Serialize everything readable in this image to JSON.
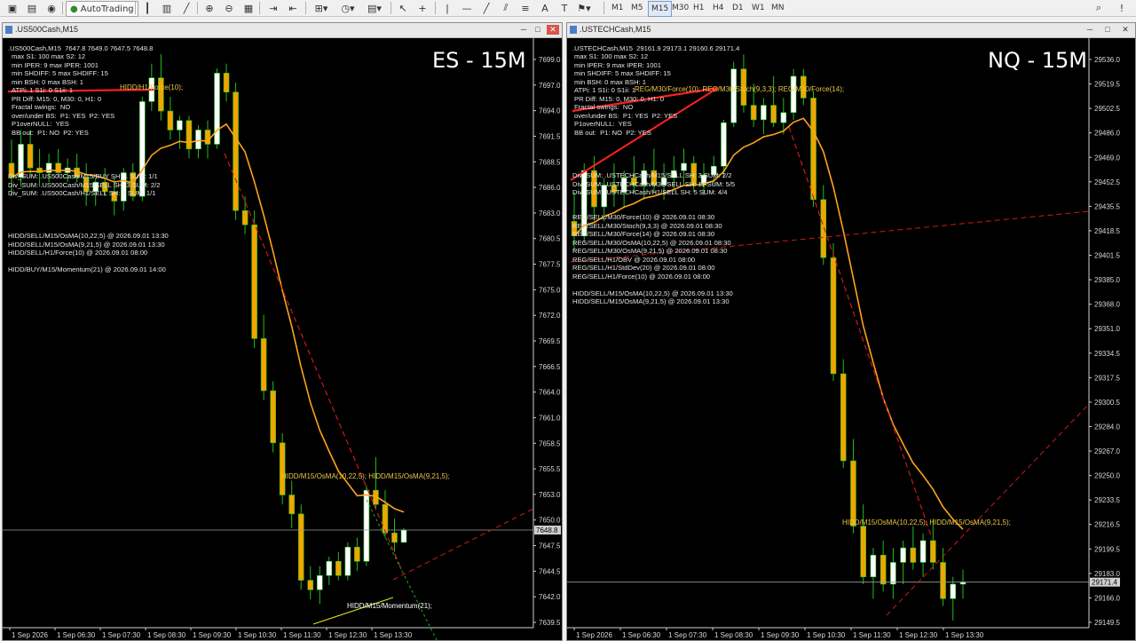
{
  "toolbar": {
    "autotrading_label": "AutoTrading",
    "timeframes": [
      "M1",
      "M5",
      "M15",
      "M30",
      "H1",
      "H4",
      "D1",
      "W1",
      "MN"
    ],
    "active_timeframe": "M15"
  },
  "windows": [
    {
      "id": "es",
      "title": ".US500Cash,M15",
      "big_label": "ES - 15M",
      "header_line": ".US500Cash,M15  7647.8 7649.0 7647.5 7648.8",
      "info_lines": [
        "max S1: 100 max S2: 12",
        "min IPER: 9 max IPER: 1001",
        "min SHDIFF: 5 max SHDIFF: 15",
        "min BSH: 0 max BSH: 1",
        "ATPi: 1 S1i: 0 S1ii: 1",
        "PR Diff: M15: 0, M30: 0, H1: 0",
        "Fractal swings:  NO",
        "over/under BS:  P1: YES  P2: YES",
        "P1overNULL:  YES",
        "BB out:  P1: NO  P2: YES"
      ],
      "div_lines": [
        "Div_SUM: .US500Cash/M15/BUY SH: 1 SUM: 1/1",
        "Div_SUM: .US500Cash/M15/SELL SH: 3 SUM: 2/2",
        "Div_SUM: .US500Cash/H1/SELL SH: 6 SUM: 1/1"
      ],
      "signal_lines": [
        "HIDD/SELL/M15/OsMA(10,22,5) @ 2026.09.01 13:30",
        "HIDD/SELL/M15/OsMA(9,21,5) @ 2026.09.01 13:30",
        "HIDD/SELL/H1/Force(10) @ 2026.09.01 08:00",
        "",
        "HIDD/BUY/M15/Momentum(21) @ 2026.09.01 14:00"
      ],
      "annotations": {
        "top": "HIDD/H1/Force(10);",
        "mid": "HIDD/M15/OsMA(10,22,5); HIDD/M15/OsMA(9,21,5);",
        "bottom": "HIDD/M15/Momentum(21);"
      },
      "price_axis": [
        "7699.0",
        "7697.0",
        "7694.0",
        "7691.5",
        "7688.5",
        "7686.0",
        "7683.0",
        "7680.5",
        "7677.5",
        "7675.0",
        "7672.0",
        "7669.5",
        "7666.5",
        "7664.0",
        "7661.0",
        "7658.5",
        "7655.5",
        "7653.0",
        "7650.0",
        "7647.5",
        "7644.5",
        "7642.0",
        "7639.5"
      ],
      "current_price": "7648.8",
      "time_axis": [
        "1 Sep 2026",
        "1 Sep 06:30",
        "1 Sep 07:30",
        "1 Sep 08:30",
        "1 Sep 09:30",
        "1 Sep 10:30",
        "1 Sep 11:30",
        "1 Sep 12:30",
        "1 Sep 13:30"
      ],
      "chart_data": {
        "type": "candlestick",
        "ylim": [
          7638.5,
          7700.5
        ],
        "candles": [
          [
            7687.5,
            7690.0,
            7684.0,
            7686.0
          ],
          [
            7686.0,
            7691.0,
            7685.0,
            7689.5
          ],
          [
            7689.5,
            7691.0,
            7686.0,
            7687.0
          ],
          [
            7687.0,
            7689.0,
            7685.0,
            7686.5
          ],
          [
            7686.5,
            7688.5,
            7685.5,
            7687.5
          ],
          [
            7687.5,
            7689.0,
            7686.0,
            7686.5
          ],
          [
            7686.5,
            7688.0,
            7685.5,
            7687.0
          ],
          [
            7687.0,
            7688.5,
            7685.5,
            7686.0
          ],
          [
            7686.0,
            7687.5,
            7683.0,
            7684.5
          ],
          [
            7684.5,
            7686.0,
            7683.0,
            7685.5
          ],
          [
            7685.5,
            7687.0,
            7684.0,
            7684.5
          ],
          [
            7684.5,
            7686.0,
            7682.0,
            7683.5
          ],
          [
            7683.5,
            7687.0,
            7682.5,
            7686.5
          ],
          [
            7686.5,
            7687.5,
            7683.5,
            7684.0
          ],
          [
            7684.0,
            7694.5,
            7683.5,
            7694.0
          ],
          [
            7694.0,
            7698.0,
            7693.0,
            7696.5
          ],
          [
            7696.5,
            7699.0,
            7692.0,
            7693.0
          ],
          [
            7693.0,
            7694.5,
            7690.0,
            7691.0
          ],
          [
            7691.0,
            7692.5,
            7689.0,
            7692.0
          ],
          [
            7692.0,
            7692.5,
            7688.0,
            7689.0
          ],
          [
            7689.0,
            7691.5,
            7688.0,
            7691.0
          ],
          [
            7691.0,
            7692.0,
            7688.0,
            7689.5
          ],
          [
            7689.5,
            7697.5,
            7689.0,
            7697.0
          ],
          [
            7697.0,
            7698.0,
            7694.0,
            7695.0
          ],
          [
            7695.0,
            7696.0,
            7681.5,
            7682.5
          ],
          [
            7682.5,
            7684.0,
            7680.0,
            7681.0
          ],
          [
            7681.0,
            7682.5,
            7668.0,
            7669.0
          ],
          [
            7669.0,
            7671.5,
            7662.5,
            7663.5
          ],
          [
            7663.5,
            7664.5,
            7657.0,
            7658.0
          ],
          [
            7658.0,
            7659.0,
            7651.5,
            7652.5
          ],
          [
            7652.5,
            7654.0,
            7649.0,
            7650.5
          ],
          [
            7650.5,
            7651.5,
            7642.5,
            7643.5
          ],
          [
            7643.5,
            7645.0,
            7641.5,
            7642.5
          ],
          [
            7642.5,
            7645.0,
            7641.0,
            7644.0
          ],
          [
            7644.0,
            7646.0,
            7643.0,
            7645.5
          ],
          [
            7645.5,
            7646.5,
            7643.5,
            7644.0
          ],
          [
            7644.0,
            7647.5,
            7643.5,
            7647.0
          ],
          [
            7647.0,
            7648.0,
            7644.5,
            7645.5
          ],
          [
            7645.5,
            7653.5,
            7645.0,
            7653.0
          ],
          [
            7653.0,
            7656.5,
            7651.0,
            7651.5
          ],
          [
            7651.5,
            7653.0,
            7648.0,
            7648.5
          ],
          [
            7648.5,
            7650.0,
            7646.5,
            7647.5
          ],
          [
            7647.5,
            7649.0,
            7647.5,
            7648.8
          ]
        ]
      }
    },
    {
      "id": "nq",
      "title": ".USTECHCash,M15",
      "big_label": "NQ - 15M",
      "header_line": ".USTECHCash,M15  29161.9 29173.1 29160.6 29171.4",
      "info_lines": [
        "max S1: 100 max S2: 12",
        "min IPER: 9 max IPER: 1001",
        "min SHDIFF: 5 max SHDIFF: 15",
        "min BSH: 0 max BSH: 1",
        "ATPi: 1 S1i: 0 S1ii: 1",
        "PR Diff: M15: 0, M30: 0, H1: 0",
        "Fractal swings:  NO",
        "over/under BS:  P1: YES  P2: YES",
        "P1overNULL:  YES",
        "BB out:  P1: NO  P2: YES"
      ],
      "div_lines": [
        "Div_SUM: .USTECHCash/M15/SELL SH: 3 SUM: 2/2",
        "Div_SUM: .USTECHCash/M30/SELL SH: 11 SUM: 5/5",
        "Div_SUM: .USTECHCash/H1/SELL SH: 5 SUM: 4/4"
      ],
      "signal_lines": [
        "REG/SELL/M30/Force(10) @ 2026.09.01 08:30",
        "REG/SELL/M30/Stoch(9,3,3) @ 2026.09.01 08:30",
        "REG/SELL/M30/Force(14) @ 2026.09.01 08:30",
        "REG/SELL/M30/OsMA(10,22,5) @ 2026.09.01 08:30",
        "REG/SELL/M30/OsMA(9,21,5) @ 2026.09.01 08:30",
        "REG/SELL/H1/OBV @ 2026.09.01 08:00",
        "REG/SELL/H1/StdDev(20) @ 2026.09.01 08:00",
        "REG/SELL/H1/Force(10) @ 2026.09.01 08:00",
        "",
        "HIDD/SELL/M15/OsMA(10,22,5) @ 2026.09.01 13:30",
        "HIDD/SELL/M15/OsMA(9,21,5) @ 2026.09.01 13:30"
      ],
      "annotations": {
        "top": "REG/M30/Force(10); REG/M30/Stoch(9,3,3); REG/M30/Force(14);",
        "mid": "HIDD/M15/OsMA(10,22,5); HIDD/M15/OsMA(9,21,5);"
      },
      "price_axis": [
        "29536.0",
        "29519.5",
        "29502.5",
        "29486.0",
        "29469.0",
        "29452.5",
        "29435.5",
        "29418.5",
        "29401.5",
        "29385.0",
        "29368.0",
        "29351.0",
        "29334.5",
        "29317.5",
        "29300.5",
        "29284.0",
        "29267.0",
        "29250.0",
        "29233.5",
        "29216.5",
        "29199.5",
        "29183.0",
        "29166.0",
        "29149.5"
      ],
      "current_price": "29171.4",
      "time_axis": [
        "1 Sep 2026",
        "1 Sep 06:30",
        "1 Sep 07:30",
        "1 Sep 08:30",
        "1 Sep 09:30",
        "1 Sep 10:30",
        "1 Sep 11:30",
        "1 Sep 12:30",
        "1 Sep 13:30"
      ],
      "chart_data": {
        "type": "candlestick",
        "ylim": [
          29140,
          29545
        ],
        "candles": [
          [
            29420,
            29440,
            29400,
            29410
          ],
          [
            29410,
            29460,
            29405,
            29455
          ],
          [
            29455,
            29465,
            29420,
            29430
          ],
          [
            29430,
            29450,
            29420,
            29445
          ],
          [
            29445,
            29460,
            29430,
            29440
          ],
          [
            29440,
            29455,
            29430,
            29450
          ],
          [
            29450,
            29465,
            29440,
            29445
          ],
          [
            29445,
            29460,
            29435,
            29455
          ],
          [
            29455,
            29470,
            29440,
            29445
          ],
          [
            29445,
            29460,
            29435,
            29450
          ],
          [
            29450,
            29465,
            29440,
            29455
          ],
          [
            29455,
            29470,
            29445,
            29460
          ],
          [
            29460,
            29465,
            29440,
            29445
          ],
          [
            29445,
            29460,
            29438,
            29452
          ],
          [
            29452,
            29465,
            29445,
            29458
          ],
          [
            29458,
            29490,
            29450,
            29488
          ],
          [
            29488,
            29530,
            29485,
            29525
          ],
          [
            29525,
            29535,
            29495,
            29500
          ],
          [
            29500,
            29515,
            29485,
            29490
          ],
          [
            29490,
            29505,
            29480,
            29500
          ],
          [
            29500,
            29520,
            29485,
            29488
          ],
          [
            29488,
            29505,
            29480,
            29495
          ],
          [
            29495,
            29525,
            29490,
            29520
          ],
          [
            29520,
            29525,
            29500,
            29505
          ],
          [
            29505,
            29510,
            29430,
            29435
          ],
          [
            29435,
            29445,
            29390,
            29395
          ],
          [
            29395,
            29405,
            29310,
            29315
          ],
          [
            29315,
            29325,
            29250,
            29255
          ],
          [
            29255,
            29270,
            29205,
            29210
          ],
          [
            29210,
            29225,
            29170,
            29175
          ],
          [
            29175,
            29195,
            29160,
            29190
          ],
          [
            29190,
            29200,
            29165,
            29170
          ],
          [
            29170,
            29195,
            29160,
            29185
          ],
          [
            29185,
            29200,
            29170,
            29195
          ],
          [
            29195,
            29210,
            29180,
            29185
          ],
          [
            29185,
            29205,
            29175,
            29200
          ],
          [
            29200,
            29215,
            29180,
            29185
          ],
          [
            29185,
            29195,
            29155,
            29160
          ],
          [
            29160,
            29175,
            29145,
            29170
          ],
          [
            29170,
            29180,
            29160,
            29171.4
          ]
        ]
      }
    }
  ]
}
